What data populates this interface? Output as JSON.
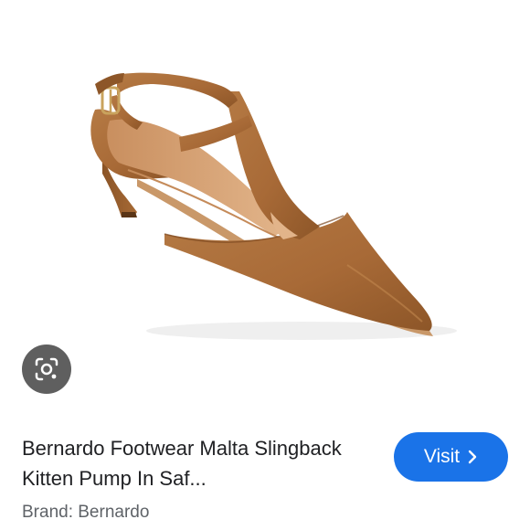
{
  "product": {
    "title": "Bernardo Footwear Malta Slingback Kitten Pump In Saf...",
    "brand": "Brand: Bernardo",
    "image_alt": "Tan suede T-strap slingback kitten heel pump"
  },
  "actions": {
    "visit_label": "Visit",
    "lens_icon": "lens-search-icon",
    "visit_icon": "chevron-right-icon"
  },
  "colors": {
    "suede": "#a86a37",
    "suede_dark": "#7e4a22",
    "lining": "#d9a679",
    "lens_bg": "#5f5f5f",
    "visit_bg": "#1a73e8",
    "title_text": "#202124",
    "brand_text": "#5f6368"
  }
}
